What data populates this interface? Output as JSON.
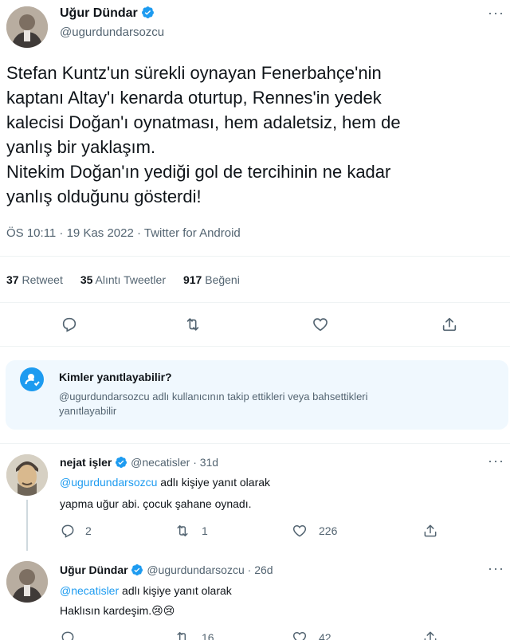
{
  "main_tweet": {
    "author_name": "Uğur Dündar",
    "author_handle": "@ugurdundarsozcu",
    "text_lines": [
      "Stefan Kuntz'un sürekli oynayan Fenerbahçe'nin",
      "kaptanı Altay'ı kenarda oturtup, Rennes'in yedek",
      "kalecisi Doğan'ı oynatması, hem  adaletsiz, hem de",
      "yanlış bir yaklaşım.",
      "Nitekim Doğan'ın yediği gol de tercihinin ne kadar",
      "yanlış olduğunu gösterdi!"
    ],
    "meta": "ÖS 10:11 · 19 Kas 2022 · Twitter for Android",
    "stats": {
      "retweets_count": "37",
      "retweets_label": "Retweet",
      "quotes_count": "35",
      "quotes_label": "Alıntı Tweetler",
      "likes_count": "917",
      "likes_label": "Beğeni"
    }
  },
  "reply_info": {
    "title": "Kimler yanıtlayabilir?",
    "line1": "@ugurdundarsozcu adlı kullanıcının takip ettikleri veya bahsettikleri",
    "line2": "yanıtlayabilir"
  },
  "replies": [
    {
      "author_name": "nejat işler",
      "author_handle": "@necatisler",
      "time": "· 31d",
      "reply_to_handle": "@ugurdundarsozcu",
      "reply_to_suffix": "adlı kişiye yanıt olarak",
      "text": "yapma uğur abi. çocuk şahane oynadı.",
      "reply_count": "2",
      "retweet_count": "1",
      "like_count": "226"
    },
    {
      "author_name": "Uğur Dündar",
      "author_handle": "@ugurdundarsozcu",
      "time": "· 26d",
      "reply_to_handle": "@necatisler",
      "reply_to_suffix": "adlı kişiye yanıt olarak",
      "text": "Haklısın kardeşim.",
      "emoji": "😢😢",
      "reply_count": "",
      "retweet_count": "16",
      "like_count": "42"
    }
  ],
  "colors": {
    "accent": "#1d9bf0",
    "muted": "#536471",
    "info_box_bg": "#f0f8fe"
  },
  "icons": [
    "verified-badge-icon",
    "reply-icon",
    "retweet-icon",
    "like-icon",
    "share-icon",
    "more-icon",
    "person-icon"
  ]
}
